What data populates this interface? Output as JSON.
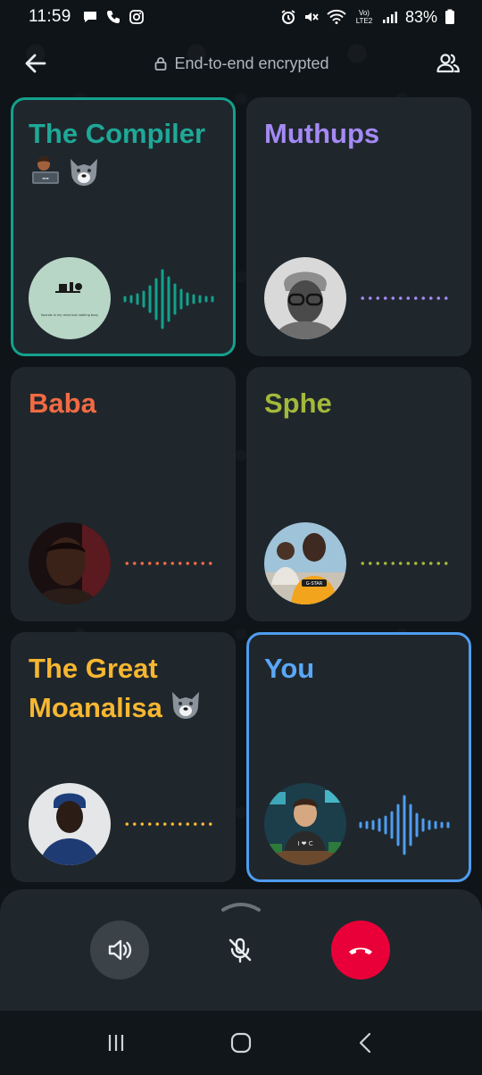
{
  "status_bar": {
    "time": "11:59",
    "battery_percent": "83%",
    "network_label": "Vo) LTE2"
  },
  "top_bar": {
    "encryption_text": "End-to-end encrypted"
  },
  "participants": [
    {
      "name": "The Compiler",
      "color": "#1fa897",
      "speaking": true,
      "state": "speaking",
      "avatar_caption": "Sounds in my mind but nothing busy"
    },
    {
      "name": "Muthups",
      "color": "#a58af5",
      "speaking": false,
      "state": "idle"
    },
    {
      "name": "Baba",
      "color": "#f26a43",
      "speaking": false,
      "state": "idle"
    },
    {
      "name": "Sphe",
      "color": "#a4b83a",
      "speaking": false,
      "state": "idle",
      "avatar_shirt_text": "G-STAR"
    },
    {
      "name_line1": "The Great",
      "name_line2": "Moanalisa",
      "color": "#f7b731",
      "speaking": false,
      "state": "idle"
    },
    {
      "name": "You",
      "color": "#5aa7f7",
      "speaking": true,
      "state": "speaking",
      "avatar_shirt_text": "I ❤ C"
    }
  ],
  "controls": {
    "speaker_icon": "speaker-icon",
    "mute_icon": "mic-off-icon",
    "end_call_icon": "end-call-icon",
    "end_call_color": "#ea0038"
  },
  "nav_bar": {
    "items": [
      "recents-icon",
      "home-icon",
      "back-icon"
    ]
  },
  "colors": {
    "background": "#0f1418",
    "tile": "#1f272d",
    "accent_green": "#13a18c",
    "accent_blue": "#4f9df0"
  }
}
